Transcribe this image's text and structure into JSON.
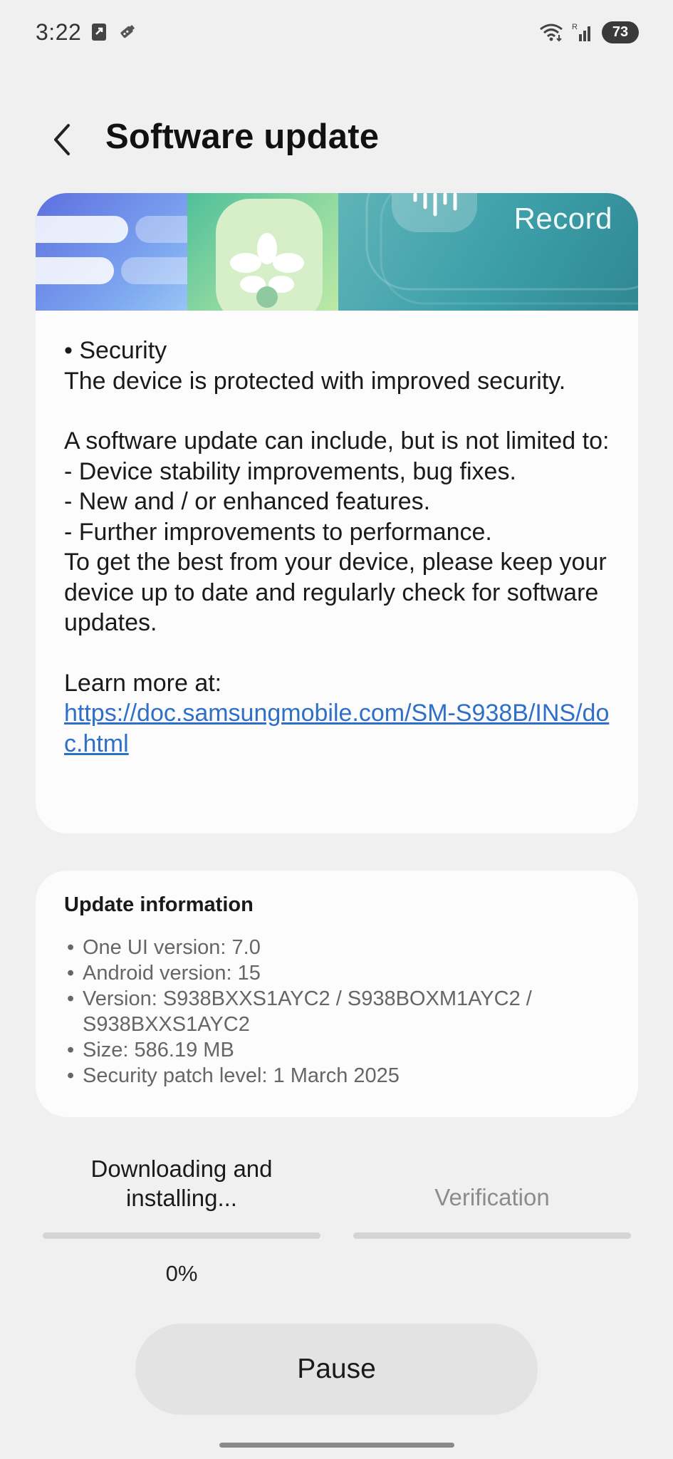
{
  "status_bar": {
    "time": "3:22",
    "notification_icons": [
      "download-app-icon",
      "usb-debug-icon"
    ],
    "right_icons": [
      "wifi-icon",
      "signal-roaming-icon"
    ],
    "battery": "73"
  },
  "header": {
    "back_icon": "chevron-left-icon",
    "title": "Software update"
  },
  "banner": {
    "record_label": "Record"
  },
  "release_notes": {
    "security_heading": "• Security",
    "security_text": "The device is protected with improved security.",
    "intro": "A software update can include, but is not limited to:",
    "items": [
      " - Device stability improvements, bug fixes.",
      " - New and / or enhanced features.",
      " - Further improvements to performance."
    ],
    "closing": "To get the best from your device, please keep your device up to date and regularly check for software updates.",
    "learn_more_label": "Learn more at:",
    "learn_more_link": "https://doc.samsungmobile.com/SM-S938B/INS/doc.html"
  },
  "update_info": {
    "title": "Update information",
    "items": [
      "One UI version: 7.0",
      "Android version: 15",
      "Version: S938BXXS1AYC2 / S938BOXM1AYC2 / S938BXXS1AYC2",
      "Size: 586.19 MB",
      "Security patch level: 1 March 2025"
    ]
  },
  "progress": {
    "step_active": "Downloading and installing...",
    "step_inactive": "Verification",
    "percent_label": "0%",
    "download_fraction": 0,
    "verification_fraction": 0
  },
  "actions": {
    "pause_label": "Pause"
  },
  "colors": {
    "background": "#f0f0f0",
    "card": "#fcfcfc",
    "link": "#2f6fc9",
    "progress_track": "#d4d4d4",
    "progress_fill": "#3e82f7"
  }
}
